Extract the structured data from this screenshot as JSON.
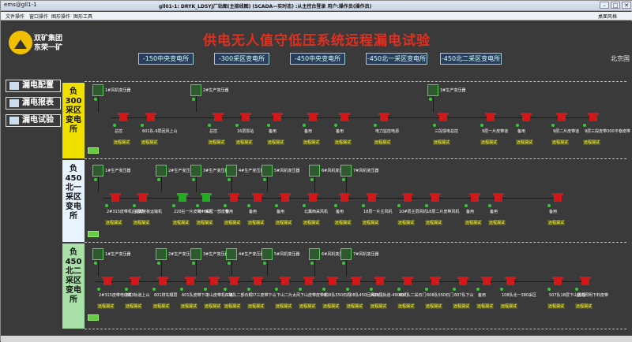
{
  "window": {
    "title": "ems@gll1-1",
    "center_title": "gll01-1: DRYK_LDSYJ厂站图(主接线图) (SCADA—实时态) :从主控台登录  用户:操作员(操作员)"
  },
  "menu": {
    "items": [
      "文件操作",
      "窗口操作",
      "图形操作",
      "图形工具"
    ],
    "right": "桌面风格"
  },
  "logo": {
    "line1": "双矿集团",
    "line2": "东荣一矿"
  },
  "title": "供电无人值守低压系统远程漏电试验",
  "substations": [
    "-150中央变电所",
    "-300采区变电所",
    "-450中央变电所",
    "-450北一采区变电所",
    "-450北二采区变电所"
  ],
  "right_text": "北京国",
  "sidebar": {
    "items": [
      {
        "label": "漏电配置"
      },
      {
        "label": "漏电报表"
      },
      {
        "label": "漏电试验"
      }
    ]
  },
  "sections": [
    {
      "label": "负300采区变电所",
      "color": "#f0e000"
    },
    {
      "label": "负450北一采区变电所",
      "color": "#e8f4ff"
    },
    {
      "label": "负450北二采区变电所",
      "color": "#a8e0a8"
    }
  ],
  "s1": {
    "xf": [
      {
        "label": "1#风机变压器"
      },
      {
        "label": "2#生产变压器"
      },
      {
        "label": "3#生产变压器"
      }
    ],
    "loads": [
      "总控",
      "601队-9层回风上山",
      "总控",
      "16层泵站",
      "备用",
      "备用",
      "备用",
      "电力监控电源",
      "三段馈电总控",
      "9层一片皮带道",
      "备用",
      "9层二片皮带道",
      "9层三段皮带300平巷皮带"
    ],
    "remote": "远程漏试"
  },
  "s2": {
    "xf": [
      {
        "label": "1#生产变压器"
      },
      {
        "label": "2#生产变压器"
      },
      {
        "label": "3#生产变压器"
      },
      {
        "label": "4#生产变压器"
      },
      {
        "label": "5#风机变压器"
      },
      {
        "label": "6#风机变压器"
      },
      {
        "label": "7#风机变压器"
      }
    ],
    "loads": [
      "2#315皮带机后驱动",
      "北翼链板运输机",
      "220右一片皮带406风",
      "北一采区一部皮带",
      "备用",
      "备用",
      "备用",
      "北翼西采风机",
      "备用",
      "18层一片主风机",
      "10#层主层风机",
      "18层二片皮带风机",
      "备用",
      "备用",
      "备用"
    ],
    "remote": "远程漏试"
  },
  "s3": {
    "xf": [
      {
        "label": "1#生产变压器"
      },
      {
        "label": "2#生产变压器"
      },
      {
        "label": "3#生产变压器"
      },
      {
        "label": "4#生产变压器"
      },
      {
        "label": "5#风机变压器"
      },
      {
        "label": "6#风机变压器"
      },
      {
        "label": "7#风机变压器"
      }
    ],
    "loads": [
      "2#315皮带电缆机",
      "603轨道上山",
      "601排车顺层",
      "601队皮带下山",
      "下山皮带机二路",
      "608队二部石门",
      "607三皮带下山",
      "下山二片太风",
      "下山皮带皮带机",
      "608队550石门",
      "608队450回风石门",
      "608队轨道-490石门",
      "608队二采石门",
      "608队550石门",
      "607队下山",
      "备用",
      "108队北一380采区",
      "507队18层下山风机",
      "室内照明下料皮带"
    ],
    "remote": "远程漏试"
  }
}
